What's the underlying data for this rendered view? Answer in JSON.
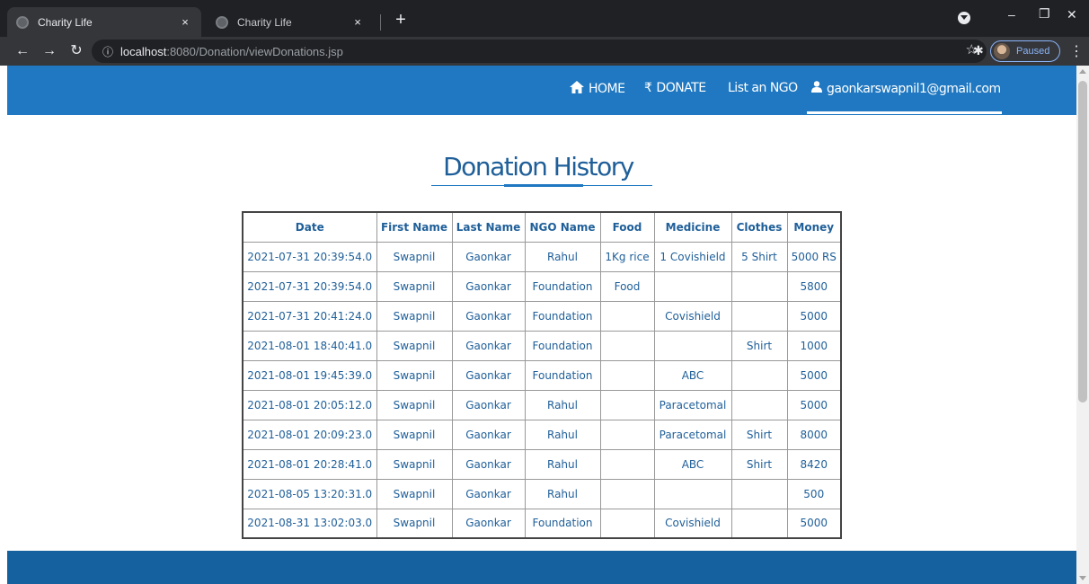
{
  "browser": {
    "tabs": [
      {
        "title": "Charity Life",
        "close": "×"
      },
      {
        "title": "Charity Life",
        "close": "×"
      }
    ],
    "new_tab": "+",
    "url_host": "localhost",
    "url_path": ":8080/Donation/viewDonations.jsp",
    "profile_status": "Paused"
  },
  "nav": {
    "home": "HOME",
    "donate": "DONATE",
    "list_ngo": "List an NGO",
    "user_email": "gaonkarswapnil1@gmail.com"
  },
  "page": {
    "title": "Donation History"
  },
  "table": {
    "headers": [
      "Date",
      "First Name",
      "Last Name",
      "NGO Name",
      "Food",
      "Medicine",
      "Clothes",
      "Money"
    ],
    "rows": [
      [
        "2021-07-31 20:39:54.0",
        "Swapnil",
        "Gaonkar",
        "Rahul",
        "1Kg rice",
        "1 Covishield",
        "5 Shirt",
        "5000 RS"
      ],
      [
        "2021-07-31 20:39:54.0",
        "Swapnil",
        "Gaonkar",
        "Foundation",
        "Food",
        "",
        "",
        "5800"
      ],
      [
        "2021-07-31 20:41:24.0",
        "Swapnil",
        "Gaonkar",
        "Foundation",
        "",
        "Covishield",
        "",
        "5000"
      ],
      [
        "2021-08-01 18:40:41.0",
        "Swapnil",
        "Gaonkar",
        "Foundation",
        "",
        "",
        "Shirt",
        "1000"
      ],
      [
        "2021-08-01 19:45:39.0",
        "Swapnil",
        "Gaonkar",
        "Foundation",
        "",
        "ABC",
        "",
        "5000"
      ],
      [
        "2021-08-01 20:05:12.0",
        "Swapnil",
        "Gaonkar",
        "Rahul",
        "",
        "Paracetomal",
        "",
        "5000"
      ],
      [
        "2021-08-01 20:09:23.0",
        "Swapnil",
        "Gaonkar",
        "Rahul",
        "",
        "Paracetomal",
        "Shirt",
        "8000"
      ],
      [
        "2021-08-01 20:28:41.0",
        "Swapnil",
        "Gaonkar",
        "Rahul",
        "",
        "ABC",
        "Shirt",
        "8420"
      ],
      [
        "2021-08-05 13:20:31.0",
        "Swapnil",
        "Gaonkar",
        "Rahul",
        "",
        "",
        "",
        "500"
      ],
      [
        "2021-08-31 13:02:03.0",
        "Swapnil",
        "Gaonkar",
        "Foundation",
        "",
        "Covishield",
        "",
        "5000"
      ]
    ]
  },
  "colors": {
    "nav_bg": "#1f78c1",
    "footer_bg": "#15609f",
    "text_accent": "#1f5f99"
  }
}
